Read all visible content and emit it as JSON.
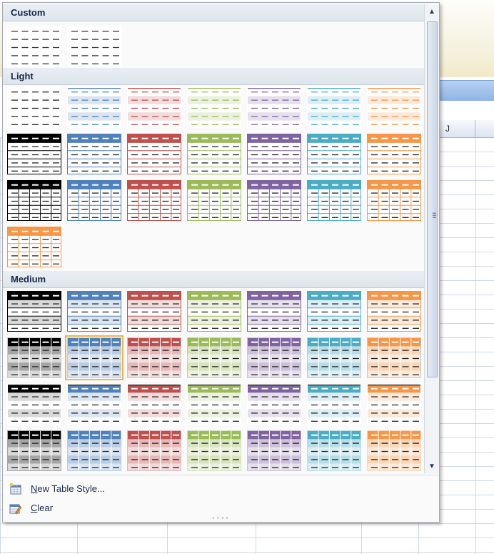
{
  "background": {
    "column_label": "J"
  },
  "gallery": {
    "sections": [
      {
        "key": "custom",
        "label": "Custom"
      },
      {
        "key": "light",
        "label": "Light"
      },
      {
        "key": "medium",
        "label": "Medium"
      }
    ],
    "colors": {
      "black": "#000000",
      "blue": "#4f81bd",
      "red": "#c0504d",
      "green": "#9bbb59",
      "purple": "#8064a2",
      "aqua": "#4bacc6",
      "orange": "#f79646",
      "selection": "#f0b548"
    },
    "selected_style": "Medium 9"
  },
  "menu": {
    "new_style": {
      "accel": "N",
      "rest": "ew Table Style...",
      "icon": "new-table-style-icon"
    },
    "clear": {
      "accel": "C",
      "rest": "lear",
      "icon": "clear-table-style-icon"
    }
  }
}
